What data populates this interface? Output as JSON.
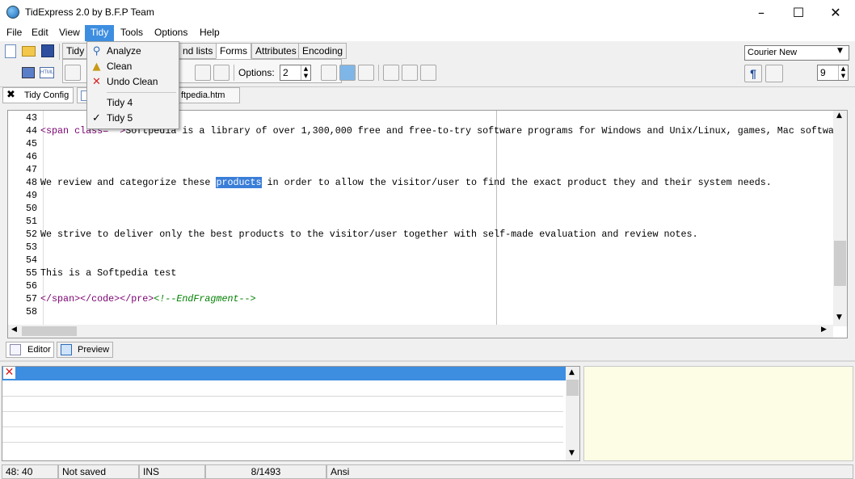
{
  "window": {
    "title": "TidExpress 2.0 by B.F.P Team"
  },
  "menubar": [
    "File",
    "Edit",
    "View",
    "Tidy",
    "Tools",
    "Options",
    "Help"
  ],
  "tidy_menu": {
    "analyze": "Analyze",
    "clean": "Clean",
    "undo_clean": "Undo Clean",
    "tidy4": "Tidy 4",
    "tidy5": "Tidy 5"
  },
  "toolbar": {
    "tabs": [
      "Tidy",
      "nd lists",
      "Forms",
      "Attributes",
      "Encoding"
    ],
    "options_label": "Options:",
    "options_value": "2",
    "font_name": "Courier New",
    "font_size": "9"
  },
  "doc_tabs": {
    "config": "Tidy Config",
    "file": "ftpedia.htm"
  },
  "editor": {
    "lines": [
      {
        "n": "43",
        "text": ""
      },
      {
        "n": "44",
        "tag1": "<span class=\"\">",
        "text": "Softpedia is a library of over 1,300,000 free and free-to-try software programs for Windows and Unix/Linux, games, Mac softwa"
      },
      {
        "n": "45",
        "text": ""
      },
      {
        "n": "46",
        "text": ""
      },
      {
        "n": "47",
        "text": ""
      },
      {
        "n": "48",
        "pre": "We review and categorize these ",
        "hl": "products",
        "post": " in order to allow the visitor/user to find the exact product they and their system needs."
      },
      {
        "n": "49",
        "text": ""
      },
      {
        "n": "50",
        "text": ""
      },
      {
        "n": "51",
        "text": ""
      },
      {
        "n": "52",
        "text": "We strive to deliver only the best products to the visitor/user together with self-made evaluation and review notes."
      },
      {
        "n": "53",
        "text": ""
      },
      {
        "n": "54",
        "text": ""
      },
      {
        "n": "55",
        "text": "This is a Softpedia test"
      },
      {
        "n": "56",
        "text": ""
      },
      {
        "n": "57",
        "tags": "</span></code></pre>",
        "comment": "<!--EndFragment-->"
      },
      {
        "n": "58",
        "text": ""
      }
    ]
  },
  "bottom_tabs": {
    "editor": "Editor",
    "preview": "Preview"
  },
  "status": {
    "position": "48: 40",
    "saved": "Not saved",
    "mode": "INS",
    "count": "8/1493",
    "encoding": "Ansi"
  },
  "colors": {
    "accent": "#3d8ee0",
    "selection": "#3a7ed8",
    "notes_bg": "#fdfde6"
  }
}
